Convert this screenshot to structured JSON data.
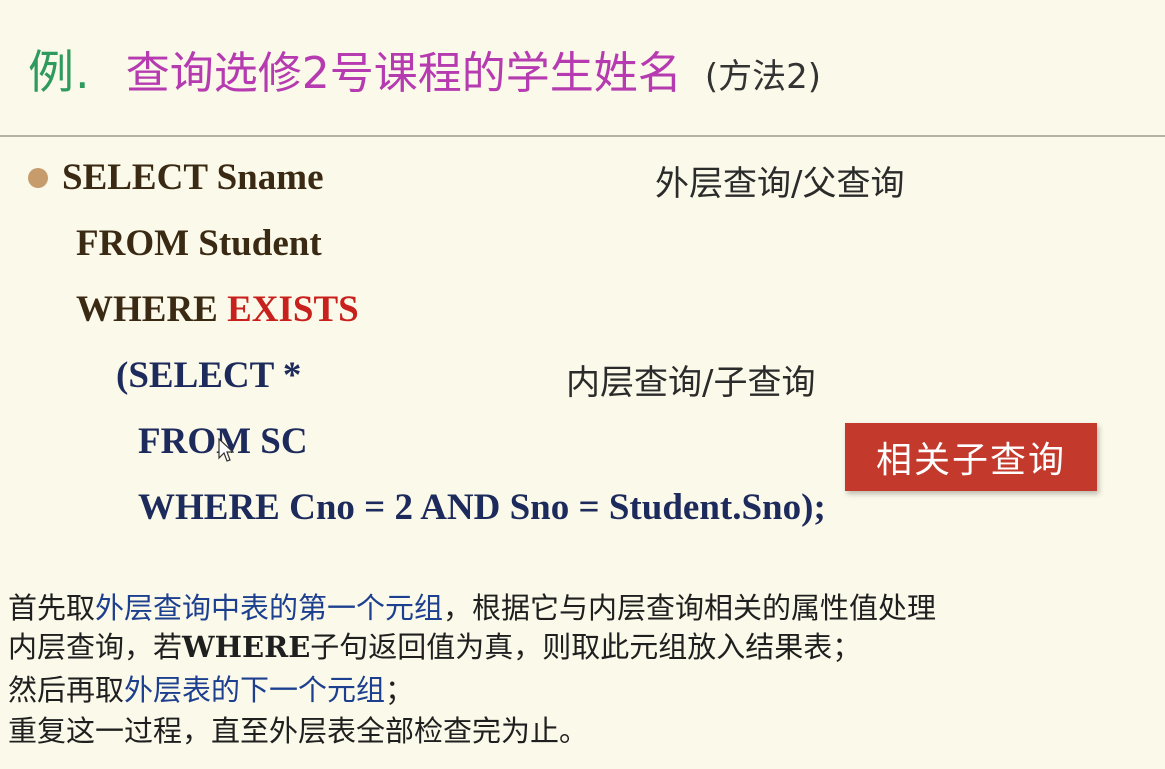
{
  "title": {
    "prefix": "例.",
    "main": "查询选修2号课程的学生姓名",
    "suffix": "(方法2)"
  },
  "query": {
    "select_outer": "SELECT Sname",
    "from_outer": "FROM Student",
    "where_keyword": "WHERE ",
    "exists_keyword": "EXISTS",
    "select_inner": "(SELECT *",
    "from_inner": "FROM SC",
    "where_inner": "WHERE Cno = 2 AND Sno = Student.Sno);"
  },
  "annotations": {
    "outer": "外层查询/父查询",
    "inner": "内层查询/子查询"
  },
  "badge": {
    "label": "相关子查询",
    "color": "#c33a2c"
  },
  "description": {
    "line1_a": "首先取",
    "line1_b": "外层查询中表的第一个元组",
    "line1_c": "，根据它与内层查询相关的属性值处理",
    "line2_a": "内层查询，若",
    "line2_b": "WHERE",
    "line2_c": "子句返回值为真，则取此元组放入结果表；",
    "line3_a": "然后再取",
    "line3_b": "外层表的下一个元组",
    "line3_c": "；",
    "line4": "重复这一过程，直至外层表全部检查完为止。"
  },
  "colors": {
    "title_prefix": "#2f9a5e",
    "title_main": "#b63bb0",
    "keyword_red": "#c8201c",
    "code_brown": "#3a2a14",
    "code_navy": "#1d2a5c",
    "highlight_blue": "#1d3f8f",
    "background": "#fbf9e9"
  },
  "icons": {
    "bullet": "bullet-dot-icon",
    "cursor": "mouse-pointer-icon"
  }
}
